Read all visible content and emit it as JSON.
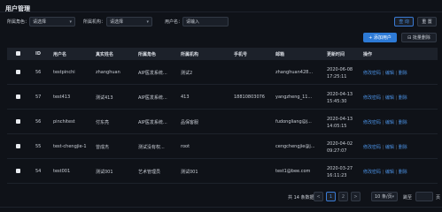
{
  "page": {
    "title": "用户管理"
  },
  "filters": {
    "role_label": "所属角色：",
    "role_value": "请选择",
    "org_label": "所属机构：",
    "org_value": "请选择",
    "user_label": "用户名：",
    "user_placeholder": "请输入"
  },
  "actions": {
    "query": "查 询",
    "reset": "重 置",
    "add": "+ 添加用户",
    "batch_delete": "批量删除"
  },
  "table": {
    "headers": [
      "ID",
      "用户名",
      "真实姓名",
      "所属角色",
      "所属机构",
      "手机号",
      "邮箱",
      "更新时间",
      "操作"
    ],
    "rows": [
      {
        "id": "56",
        "username": "testpinchi",
        "realname": "zhanghuan",
        "role": "AIP医发系统...",
        "org": "测试2",
        "phone": "",
        "email": "zhanghuan428...",
        "time1": "2020-06-08",
        "time2": "17:25:11"
      },
      {
        "id": "57",
        "username": "test413",
        "realname": "测试413",
        "role": "AIP医发系统...",
        "org": "413",
        "phone": "18810803076",
        "email": "yangzheng_11...",
        "time1": "2020-04-13",
        "time2": "15:45:30"
      },
      {
        "id": "56",
        "username": "pinchitest",
        "realname": "付东亮",
        "role": "AIP医发系统...",
        "org": "品保客服",
        "phone": "",
        "email": "fudongliang@j...",
        "time1": "2020-04-13",
        "time2": "14:05:15"
      },
      {
        "id": "55",
        "username": "test-chengjie-1",
        "realname": "曾成杰",
        "role": "测试没有权...",
        "org": "root",
        "phone": "",
        "email": "cengchengjie@j...",
        "time1": "2020-04-02",
        "time2": "09:27:07"
      },
      {
        "id": "54",
        "username": "test001",
        "realname": "测试001",
        "role": "艺术管理员",
        "org": "测试001",
        "phone": "",
        "email": "test1@bee.com",
        "time1": "2020-03-27",
        "time2": "16:11:23"
      },
      {
        "id": "",
        "username": "",
        "realname": "",
        "role": "",
        "org": "",
        "phone": "",
        "email": "",
        "time1": "2020-03-24",
        "time2": ""
      }
    ],
    "op_edit_pwd": "修改密码",
    "op_edit": "编辑",
    "op_delete": "删除",
    "op_sep": "|"
  },
  "pager": {
    "total": "共 14 条数据",
    "prev": "<",
    "page1": "1",
    "page2": "2",
    "next": ">",
    "size": "10 条/页",
    "goto": "跳至",
    "unit": "页"
  }
}
